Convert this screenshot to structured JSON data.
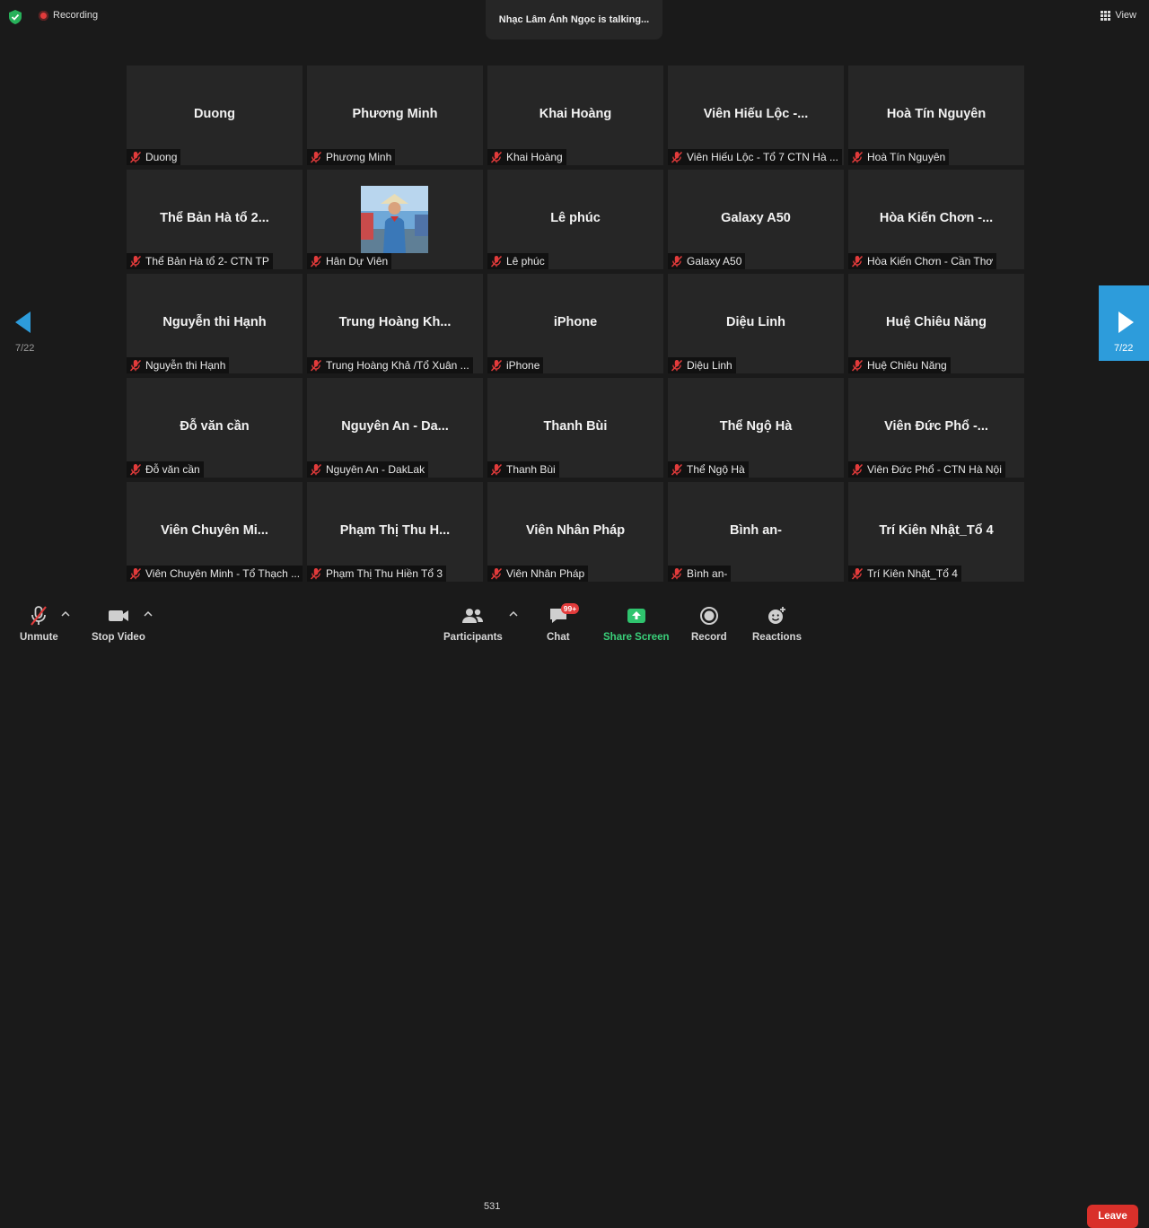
{
  "top": {
    "recording_label": "Recording",
    "talking_text": "Nhạc Lâm Ánh Ngọc is talking...",
    "view_label": "View"
  },
  "pager": {
    "left_page": "7/22",
    "right_page": "7/22"
  },
  "tiles": [
    {
      "title": "Duong",
      "label": "Duong"
    },
    {
      "title": "Phương Minh",
      "label": "Phương Minh"
    },
    {
      "title": "Khai Hoàng",
      "label": "Khai Hoàng"
    },
    {
      "title": "Viên Hiếu Lộc -...",
      "label": "Viên Hiếu Lộc - Tổ 7 CTN Hà ..."
    },
    {
      "title": "Hoà Tín Nguyên",
      "label": "Hoà Tín Nguyên"
    },
    {
      "title": "Thể Bản Hà tổ 2...",
      "label": "Thể Bản Hà tổ 2- CTN TP"
    },
    {
      "title": "",
      "label": "Hân Dự Viên",
      "has_photo": true
    },
    {
      "title": "Lê phúc",
      "label": "Lê phúc"
    },
    {
      "title": "Galaxy A50",
      "label": "Galaxy A50"
    },
    {
      "title": "Hòa Kiến Chơn -...",
      "label": "Hòa Kiến Chơn - Cần Thơ"
    },
    {
      "title": "Nguyễn thi Hạnh",
      "label": "Nguyễn thi Hạnh"
    },
    {
      "title": "Trung Hoàng Kh...",
      "label": "Trung Hoàng Khả /Tổ Xuân ..."
    },
    {
      "title": "iPhone",
      "label": "iPhone"
    },
    {
      "title": "Diệu Linh",
      "label": "Diệu Linh"
    },
    {
      "title": "Huệ Chiêu Năng",
      "label": "Huệ Chiêu Năng"
    },
    {
      "title": "Đỗ văn cần",
      "label": "Đỗ văn cần"
    },
    {
      "title": "Nguyên An - Da...",
      "label": "Nguyên An - DakLak"
    },
    {
      "title": "Thanh Bùi",
      "label": "Thanh Bùi"
    },
    {
      "title": "Thể Ngộ Hà",
      "label": "Thể Ngộ Hà"
    },
    {
      "title": "Viên Đức Phổ -...",
      "label": "Viên Đức Phổ - CTN Hà Nội"
    },
    {
      "title": "Viên Chuyên Mi...",
      "label": "Viên Chuyên Minh - Tổ Thạch ..."
    },
    {
      "title": "Phạm Thị Thu H...",
      "label": "Phạm Thị Thu Hiền Tổ 3"
    },
    {
      "title": "Viên Nhân Pháp",
      "label": "Viên Nhân Pháp"
    },
    {
      "title": "Bình an-",
      "label": "Bình an-"
    },
    {
      "title": "Trí Kiên Nhật_Tổ 4",
      "label": "Trí Kiên Nhật_Tổ 4"
    }
  ],
  "toolbar": {
    "unmute": "Unmute",
    "stop_video": "Stop Video",
    "participants": "Participants",
    "participants_count": "531",
    "chat": "Chat",
    "chat_badge": "99+",
    "share_screen": "Share Screen",
    "record": "Record",
    "reactions": "Reactions",
    "leave": "Leave"
  },
  "colors": {
    "background": "#1a1a1a",
    "tile": "#262626",
    "accent_blue": "#2d9cdb",
    "share_green": "#3ad07a",
    "leave_red": "#d9302a",
    "muted_red": "#e23b3b"
  },
  "icons": [
    "shield-icon",
    "recording-icon",
    "grid-view-icon",
    "mic-muted-icon",
    "video-icon",
    "participants-icon",
    "chat-icon",
    "share-screen-icon",
    "record-icon",
    "reactions-icon"
  ]
}
